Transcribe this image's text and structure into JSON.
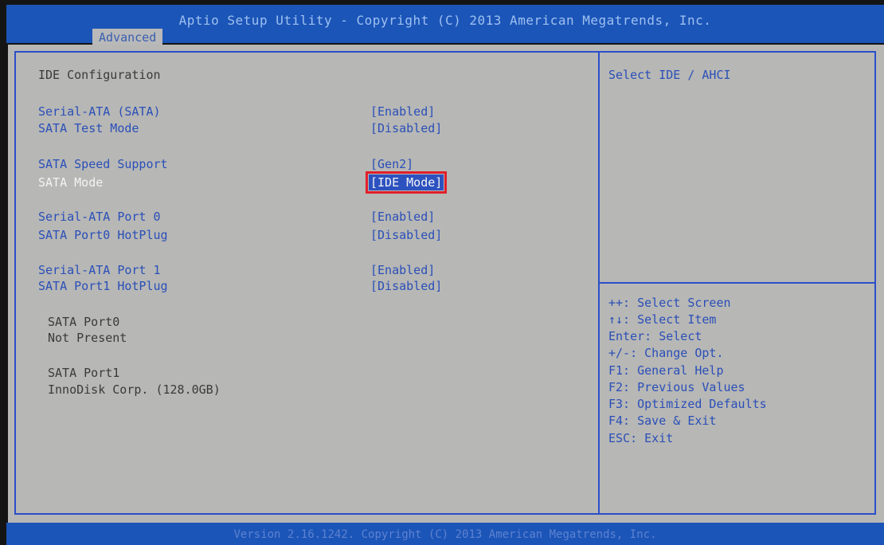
{
  "header": {
    "title": "Aptio Setup Utility - Copyright (C) 2013 American Megatrends, Inc.",
    "active_tab": "Advanced"
  },
  "main": {
    "section_title": "IDE Configuration",
    "settings": [
      {
        "label": "Serial-ATA (SATA)",
        "value": "[Enabled]"
      },
      {
        "label": "SATA Test Mode",
        "value": "[Disabled]"
      },
      {
        "label": "SATA Speed Support",
        "value": "[Gen2]"
      },
      {
        "label": "SATA Mode",
        "value": "[IDE Mode]",
        "selected": true
      },
      {
        "label": "Serial-ATA Port 0",
        "value": "[Enabled]"
      },
      {
        "label": "SATA Port0 HotPlug",
        "value": "[Disabled]"
      },
      {
        "label": "Serial-ATA Port 1",
        "value": "[Enabled]"
      },
      {
        "label": "SATA Port1 HotPlug",
        "value": "[Disabled]"
      }
    ],
    "ports": [
      {
        "name": "SATA Port0",
        "device": "Not Present"
      },
      {
        "name": "SATA Port1",
        "device": "InnoDisk Corp. (128.0GB)"
      }
    ]
  },
  "help": {
    "description": "Select IDE / AHCI",
    "keys": [
      "++: Select Screen",
      "↑↓: Select Item",
      "Enter: Select",
      "+/-: Change Opt.",
      "F1: General Help",
      "F2: Previous Values",
      "F3: Optimized Defaults",
      "F4: Save & Exit",
      "ESC: Exit"
    ]
  },
  "footer": {
    "version": "Version 2.16.1242. Copyright (C) 2013 American Megatrends, Inc."
  },
  "colors": {
    "bar_blue": "#1c55b8",
    "panel_gray": "#b7b7b5",
    "text_blue": "#2a4fb8",
    "highlight_border": "#e0202a"
  }
}
